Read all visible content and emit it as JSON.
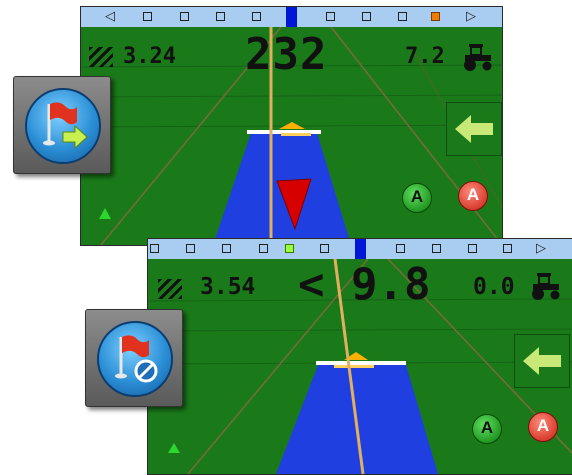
{
  "screen1": {
    "area_value": "3.24",
    "center_value": "232",
    "speed_value": "7.2",
    "lightbar_active": "center-right",
    "side_arrow_icon": "arrow-left-icon",
    "mark_a_label": "A",
    "mark_b_label": "A"
  },
  "screen2": {
    "area_value": "3.54",
    "center_value": "< 9.8",
    "speed_value": "0.0",
    "side_arrow_icon": "arrow-left-icon",
    "mark_a_label": "A",
    "mark_b_label": "A"
  },
  "buttons": {
    "flag_goto": "flag-arrow-icon",
    "flag_cancel": "flag-cancel-icon"
  },
  "colors": {
    "field": "#1a7a1a",
    "lightbar": "#a9cdf0",
    "swath": "#1f3fe0",
    "guidance_line": "#e0b060",
    "heading_arrow": "#d60000",
    "orange_cell": "#f07d00",
    "green_cell": "#9dff3a"
  }
}
